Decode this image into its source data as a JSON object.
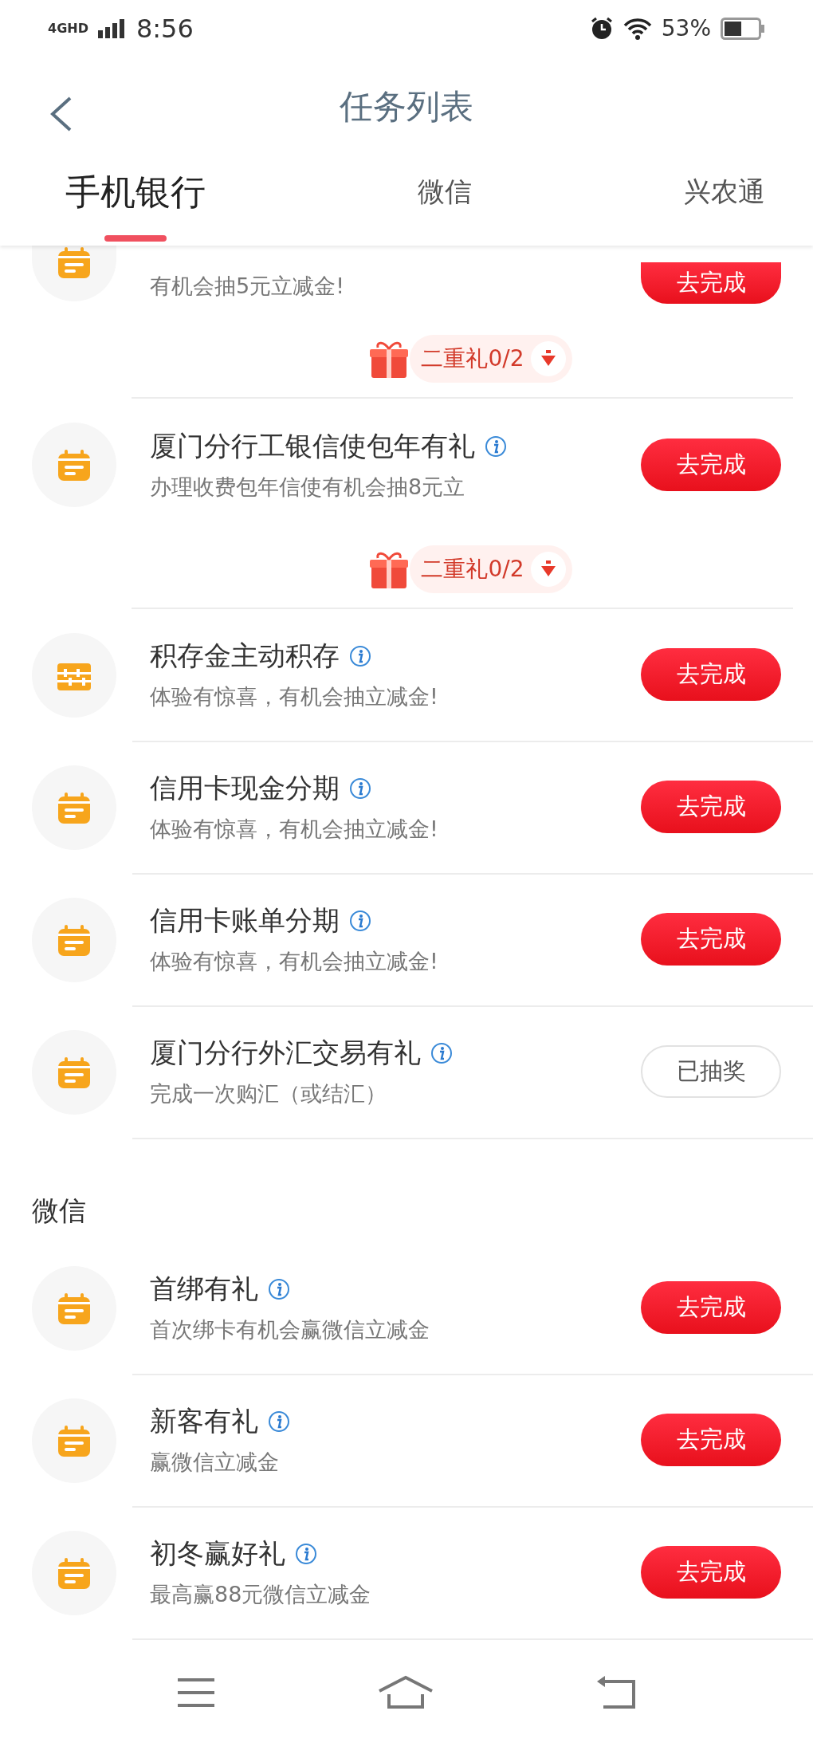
{
  "status_bar": {
    "network": "4GHD",
    "time": "8:56",
    "battery": "53%"
  },
  "header": {
    "title": "任务列表"
  },
  "tabs": [
    {
      "label": "手机银行",
      "selected": true
    },
    {
      "label": "微信",
      "selected": false
    },
    {
      "label": "兴农通",
      "selected": false
    }
  ],
  "sections": [
    {
      "tasks": [
        {
          "kind": "calendar",
          "subtitle": "有机会抽5元立减金!",
          "action": {
            "label": "去完成",
            "kind": "go"
          },
          "gift": {
            "label": "二重礼0/2"
          }
        },
        {
          "kind": "calendar",
          "title": "厦门分行工银信使包年有礼",
          "subtitle": "办理收费包年信使有机会抽8元立",
          "action": {
            "label": "去完成",
            "kind": "go"
          },
          "gift": {
            "label": "二重礼0/2"
          }
        },
        {
          "kind": "abacus",
          "title": "积存金主动积存",
          "subtitle": "体验有惊喜，有机会抽立减金!",
          "action": {
            "label": "去完成",
            "kind": "go"
          }
        },
        {
          "kind": "calendar",
          "title": "信用卡现金分期",
          "subtitle": "体验有惊喜，有机会抽立减金!",
          "action": {
            "label": "去完成",
            "kind": "go"
          }
        },
        {
          "kind": "calendar",
          "title": "信用卡账单分期",
          "subtitle": "体验有惊喜，有机会抽立减金!",
          "action": {
            "label": "去完成",
            "kind": "go"
          }
        },
        {
          "kind": "calendar",
          "title": "厦门分行外汇交易有礼",
          "subtitle": "完成一次购汇（或结汇）",
          "action": {
            "label": "已抽奖",
            "kind": "done"
          }
        }
      ]
    },
    {
      "title": "微信",
      "tasks": [
        {
          "kind": "calendar",
          "title": "首绑有礼",
          "subtitle": "首次绑卡有机会赢微信立减金",
          "action": {
            "label": "去完成",
            "kind": "go"
          }
        },
        {
          "kind": "calendar",
          "title": "新客有礼",
          "subtitle": "赢微信立减金",
          "action": {
            "label": "去完成",
            "kind": "go"
          }
        },
        {
          "kind": "calendar",
          "title": "初冬赢好礼",
          "subtitle": "最高赢88元微信立减金",
          "action": {
            "label": "去完成",
            "kind": "go"
          }
        }
      ]
    }
  ]
}
